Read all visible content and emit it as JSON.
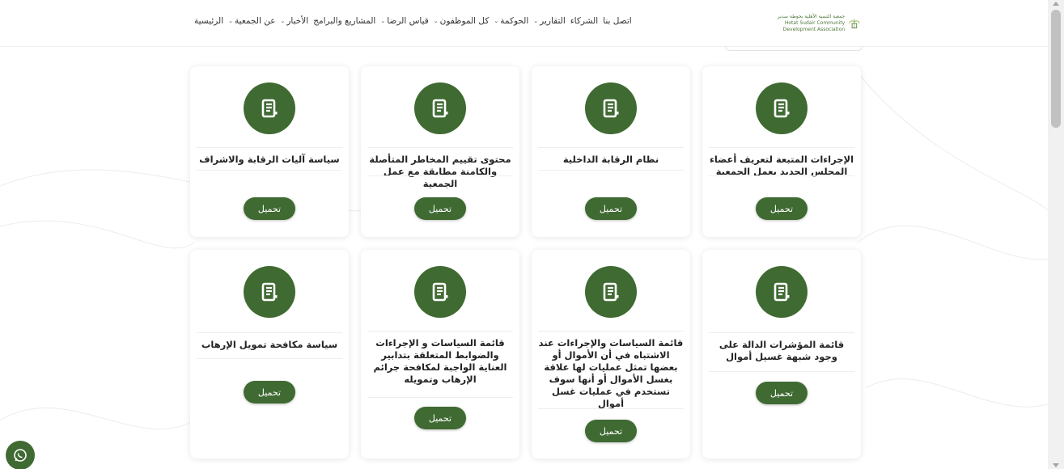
{
  "header": {
    "logo_text_line1": "جمعية التنمية الأهلية بحوطة سدير",
    "logo_text_line2": "Hotat Sudair Community Development Association",
    "nav": [
      {
        "label": "الرئيسية",
        "dropdown": false
      },
      {
        "label": "عن الجمعية",
        "dropdown": true
      },
      {
        "label": "الأخبار",
        "dropdown": true
      },
      {
        "label": "المشاريع والبرامج",
        "dropdown": false
      },
      {
        "label": "قياس الرضا",
        "dropdown": true
      },
      {
        "label": "كل الموظفون",
        "dropdown": true
      },
      {
        "label": "الحوكمة",
        "dropdown": true
      },
      {
        "label": "التقارير",
        "dropdown": true
      },
      {
        "label": "الشركاء",
        "dropdown": false
      },
      {
        "label": "اتصل بنا",
        "dropdown": false
      }
    ]
  },
  "cards": [
    {
      "title": "الإجراءات المتبعة لتعريف أعضاء المجلس الجديد بعمل الجمعية",
      "button": "تحميل",
      "icon": "document-icon"
    },
    {
      "title": "نظام الرقابة الداخلية",
      "button": "تحميل",
      "icon": "document-icon"
    },
    {
      "title": "محتوى تقييم المخاطر المتأصلة والكامنة مطابقة مع عمل الجمعية",
      "button": "تحميل",
      "icon": "document-icon"
    },
    {
      "title": "سياسة آليات الرقابة والاشراف",
      "button": "تحميل",
      "icon": "document-icon"
    },
    {
      "title": "قائمة المؤشرات الدالة على وجود شبهة غسيل أموال",
      "button": "تحميل",
      "icon": "document-icon"
    },
    {
      "title": "قائمة السياسات والإجراءات عند الاشتباه في أن الأموال أو بعضها تمثل عمليات لها علاقة بغسل الأموال أو أنها سوف تستخدم في عمليات غسل أموال",
      "button": "تحميل",
      "icon": "document-icon"
    },
    {
      "title": "قائمة السياسات و الإجراءات والضوابط المتعلقة بتدابير العناية الواجبة لمكافحة جرائم الإرهاب وتمويله",
      "button": "تحميل",
      "icon": "document-icon"
    },
    {
      "title": "سياسة مكافحة تمويل الإرهاب",
      "button": "تحميل",
      "icon": "document-icon"
    }
  ],
  "colors": {
    "brand_green": "#3f6a32",
    "background": "#ffffff"
  },
  "floating": {
    "icon": "whatsapp-icon"
  }
}
